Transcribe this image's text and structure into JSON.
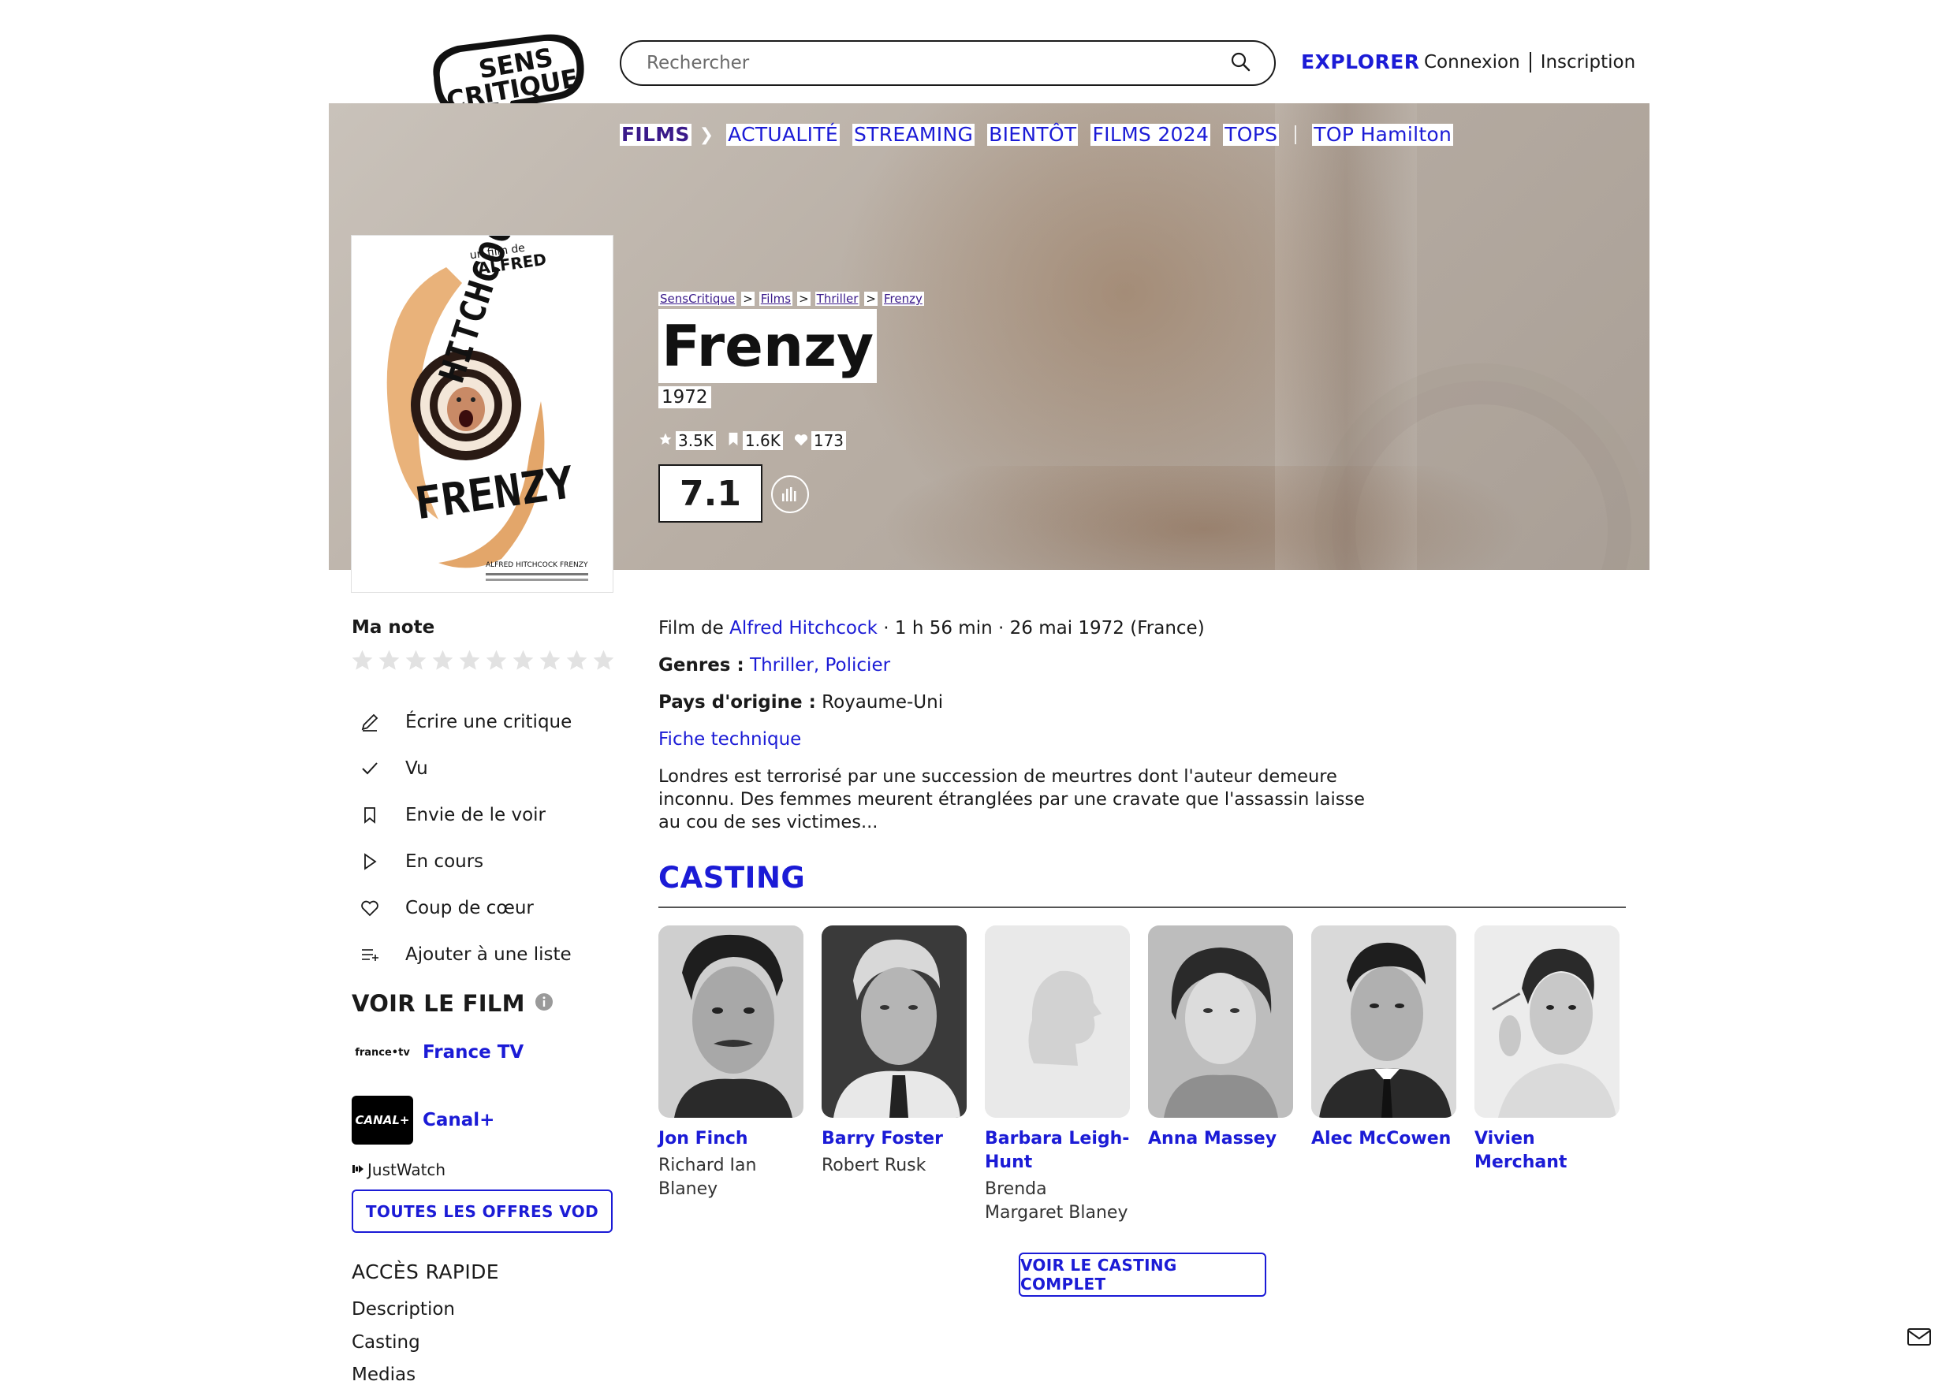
{
  "header": {
    "logo_line1": "SENS",
    "logo_line2": "CRITIQUE",
    "search_placeholder": "Rechercher",
    "explorer": "EXPLORER",
    "login": "Connexion",
    "signup": "Inscription"
  },
  "nav": {
    "films": "FILMS",
    "items": [
      "ACTUALITÉ",
      "STREAMING",
      "BIENTÔT",
      "FILMS 2024",
      "TOPS"
    ],
    "top": "TOP Hamilton"
  },
  "breadcrumb": [
    "SensCritique",
    "Films",
    "Thriller",
    "Frenzy"
  ],
  "breadcrumb_sep": ">",
  "movie": {
    "title": "Frenzy",
    "year": "1972",
    "ratings_count": "3.5K",
    "wishes_count": "1.6K",
    "likes_count": "173",
    "score": "7.1",
    "meta_prefix": "Film de ",
    "director": "Alfred Hitchcock",
    "meta_suffix": " · 1 h 56 min · 26 mai 1972 (France)",
    "genres_label": "Genres :",
    "genre1": "Thriller",
    "genre_sep": ", ",
    "genre2": "Policier",
    "country_label": "Pays d'origine :",
    "country": " Royaume-Uni",
    "fiche": "Fiche technique",
    "synopsis": "Londres est terrorisé par une succession de meurtres dont l'auteur demeure inconnu. Des femmes meurent étranglées par une cravate que l'assassin laisse au cou de ses victimes..."
  },
  "poster": {
    "top_text": "un film de",
    "director_first": "ALFRED",
    "director_last": "HITCHCOCK",
    "title": "FRENZY",
    "credit": "ALFRED HITCHCOCK FRENZY"
  },
  "sidebar": {
    "ma_note": "Ma note",
    "star_count": 10,
    "actions": [
      {
        "label": "Écrire une critique",
        "icon": "pencil-icon"
      },
      {
        "label": "Vu",
        "icon": "check-icon"
      },
      {
        "label": "Envie de le voir",
        "icon": "bookmark-icon"
      },
      {
        "label": "En cours",
        "icon": "play-icon"
      },
      {
        "label": "Coup de cœur",
        "icon": "heart-icon"
      },
      {
        "label": "Ajouter à une liste",
        "icon": "list-add-icon"
      }
    ],
    "voir_le_film": "VOIR LE FILM",
    "providers": [
      {
        "logo": "france•tv",
        "name": "France TV"
      },
      {
        "logo": "CANAL+",
        "name": "Canal+"
      }
    ],
    "justwatch": "JustWatch",
    "vod_button": "TOUTES LES OFFRES VOD",
    "acces_rapide": "ACCÈS RAPIDE",
    "quick_links": [
      "Description",
      "Casting",
      "Medias"
    ]
  },
  "casting": {
    "title": "CASTING",
    "actors": [
      {
        "name": "Jon Finch",
        "role": "Richard Ian Blaney"
      },
      {
        "name": "Barry Foster",
        "role": "Robert Rusk"
      },
      {
        "name": "Barbara Leigh-Hunt",
        "role": "Brenda Margaret Blaney"
      },
      {
        "name": "Anna Massey",
        "role": ""
      },
      {
        "name": "Alec McCowen",
        "role": ""
      },
      {
        "name": "Vivien Merchant",
        "role": ""
      }
    ],
    "button": "VOIR LE CASTING COMPLET"
  },
  "colors": {
    "accent": "#1b1bd6",
    "films_nav": "#3a1a8a",
    "text": "#1a1a1a"
  }
}
